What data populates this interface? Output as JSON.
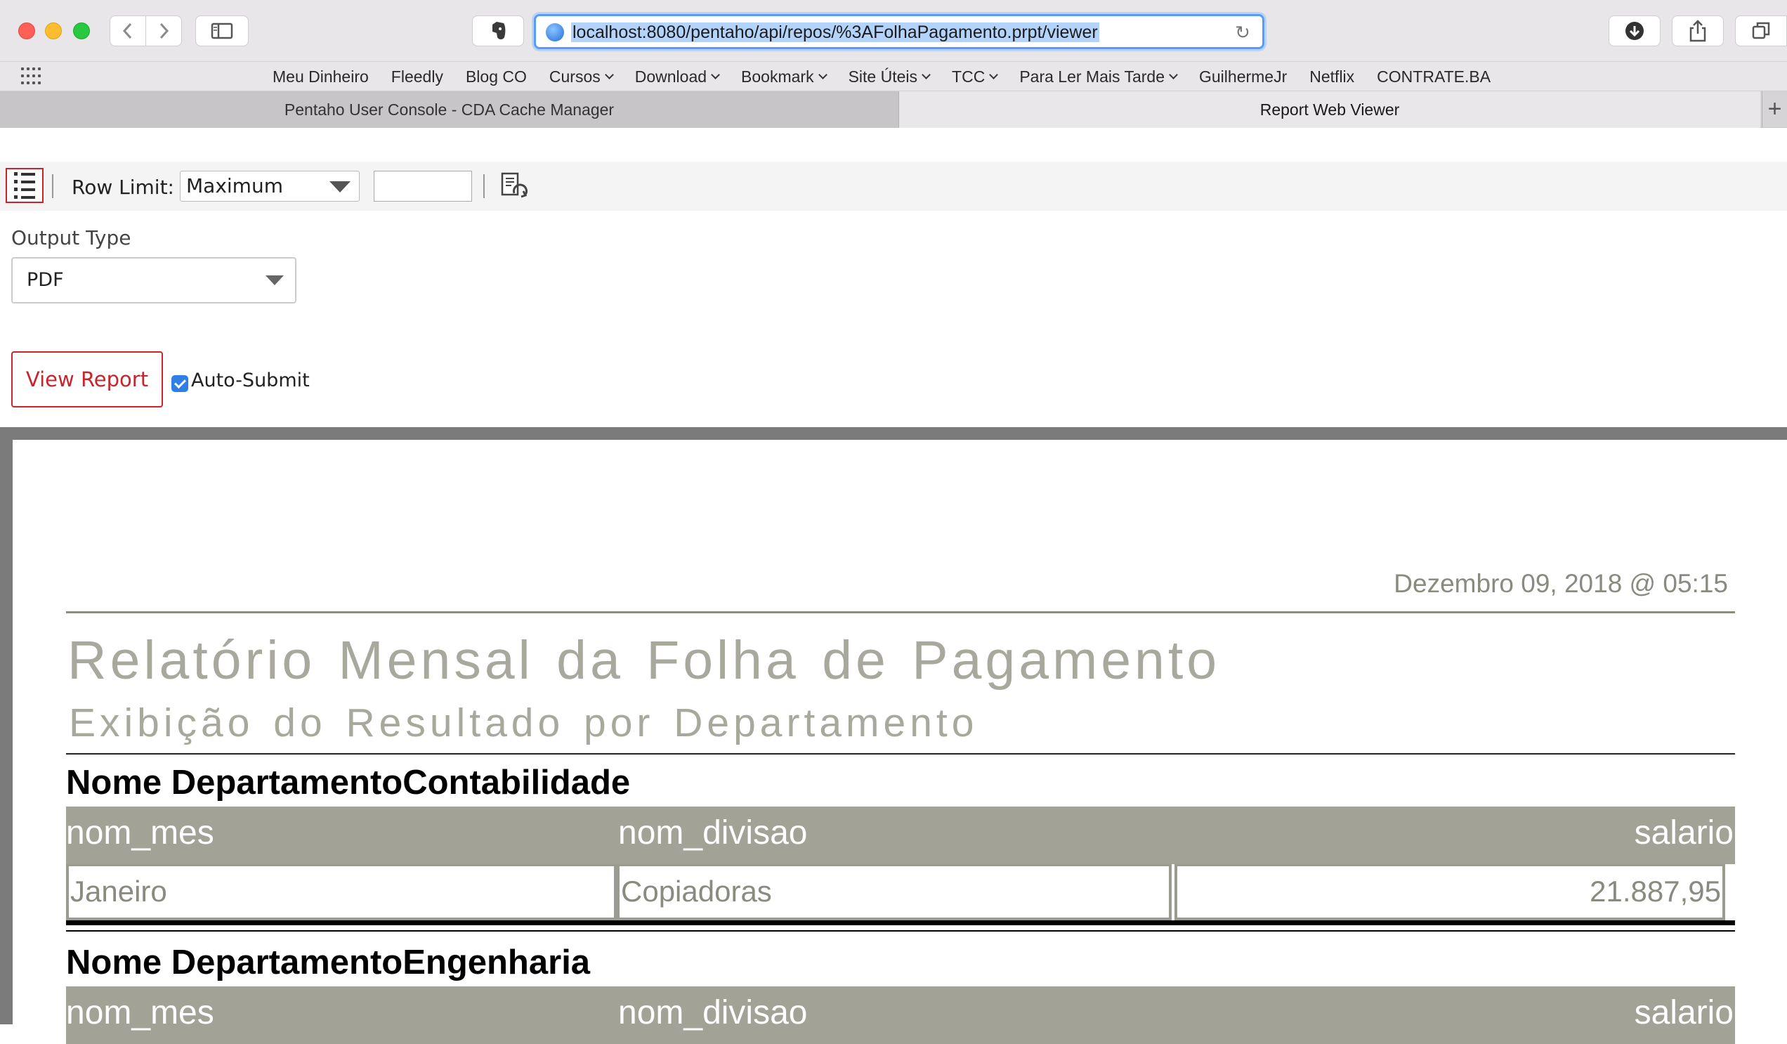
{
  "browser": {
    "url": "localhost:8080/pentaho/api/repos/%3AFolhaPagamento.prpt/viewer",
    "favorites": [
      {
        "label": "Meu Dinheiro",
        "menu": false
      },
      {
        "label": "Fleedly",
        "menu": false
      },
      {
        "label": "Blog CO",
        "menu": false
      },
      {
        "label": "Cursos",
        "menu": true
      },
      {
        "label": "Download",
        "menu": true
      },
      {
        "label": "Bookmark",
        "menu": true
      },
      {
        "label": "Site Úteis",
        "menu": true
      },
      {
        "label": "TCC",
        "menu": true
      },
      {
        "label": "Para Ler Mais Tarde",
        "menu": true
      },
      {
        "label": "GuilhermeJr",
        "menu": false
      },
      {
        "label": "Netflix",
        "menu": false
      },
      {
        "label": "CONTRATE.BA",
        "menu": false
      }
    ],
    "tabs": [
      {
        "label": "Pentaho User Console - CDA Cache Manager",
        "active": false
      },
      {
        "label": "Report Web Viewer",
        "active": true
      }
    ],
    "new_tab_symbol": "+"
  },
  "toolbar": {
    "row_limit_label": "Row Limit:",
    "row_limit_value": "Maximum",
    "row_limit_input": "",
    "refresh_icon": "refresh-report-icon"
  },
  "params": {
    "output_type_label": "Output Type",
    "output_type_value": "PDF",
    "view_report_label": "View Report",
    "auto_submit_label": "Auto-Submit",
    "auto_submit_checked": true
  },
  "report": {
    "date": "Dezembro 09, 2018 @ 05:15",
    "title": "Relatório Mensal da Folha de Pagamento",
    "subtitle": "Exibição do Resultado por Departamento",
    "columns": [
      "nom_mes",
      "nom_divisao",
      "salario"
    ],
    "groups": [
      {
        "heading": "Nome DepartamentoContabilidade",
        "rows": [
          {
            "nom_mes": "Janeiro",
            "nom_divisao": "Copiadoras",
            "salario": "21.887,95"
          }
        ]
      },
      {
        "heading": "Nome DepartamentoEngenharia",
        "rows": []
      }
    ]
  },
  "colors": {
    "accent_red": "#c8242c",
    "header_bg": "#a3a297",
    "title_gray": "#a8a89c",
    "url_highlight": "#b3d3fb"
  }
}
